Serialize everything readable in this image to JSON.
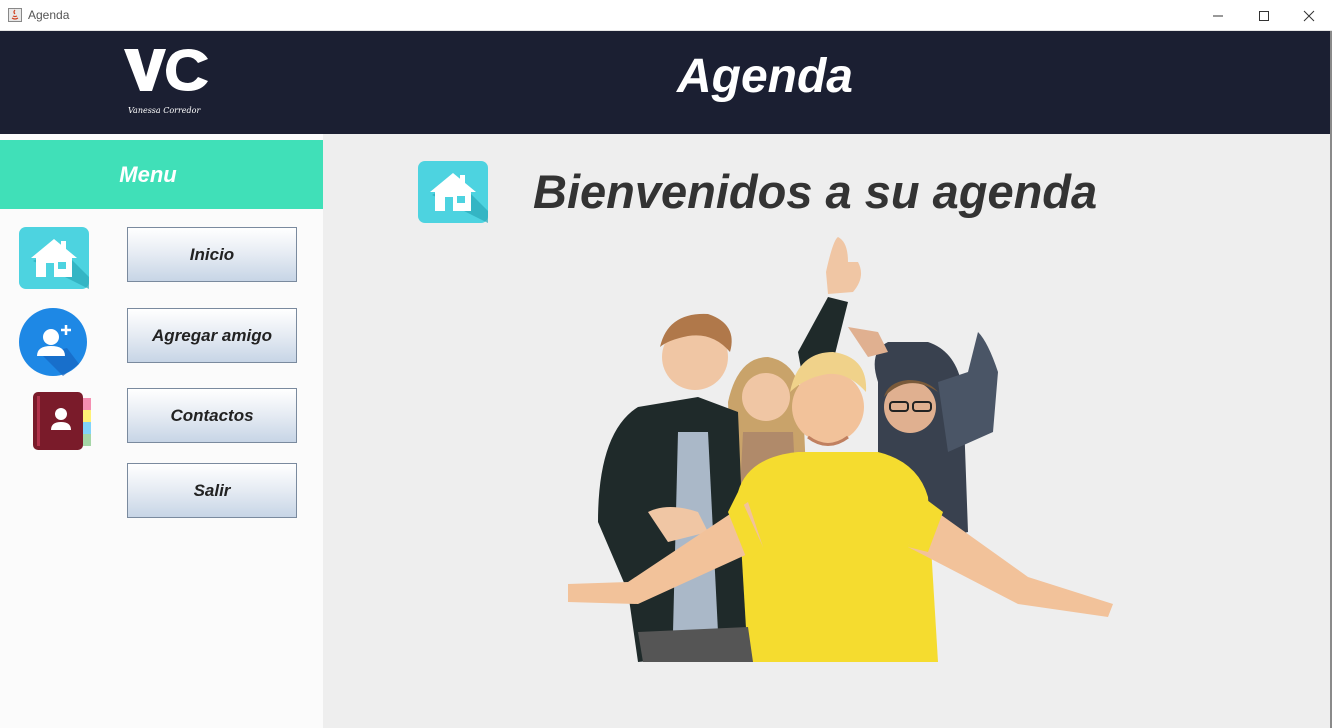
{
  "window": {
    "title": "Agenda",
    "controls": {
      "minimize": "minimize-icon",
      "maximize": "maximize-icon",
      "close": "close-icon"
    }
  },
  "header": {
    "logo_text": "Vanessa Corredor",
    "title": "Agenda"
  },
  "sidebar": {
    "menu_label": "Menu",
    "items": [
      {
        "label": "Inicio",
        "icon": "home-icon"
      },
      {
        "label": "Agregar amigo",
        "icon": "add-user-icon"
      },
      {
        "label": "Contactos",
        "icon": "address-book-icon"
      },
      {
        "label": "Salir",
        "icon": ""
      }
    ]
  },
  "main": {
    "heading": "Bienvenidos a su agenda",
    "icon": "home-icon"
  },
  "colors": {
    "header_bg": "#1b1f32",
    "menu_bar": "#40e0b8",
    "main_bg": "#eeeeee",
    "icon_teal": "#4dd3e0",
    "icon_blue": "#1e88e5",
    "icon_book": "#7a1b2a"
  }
}
